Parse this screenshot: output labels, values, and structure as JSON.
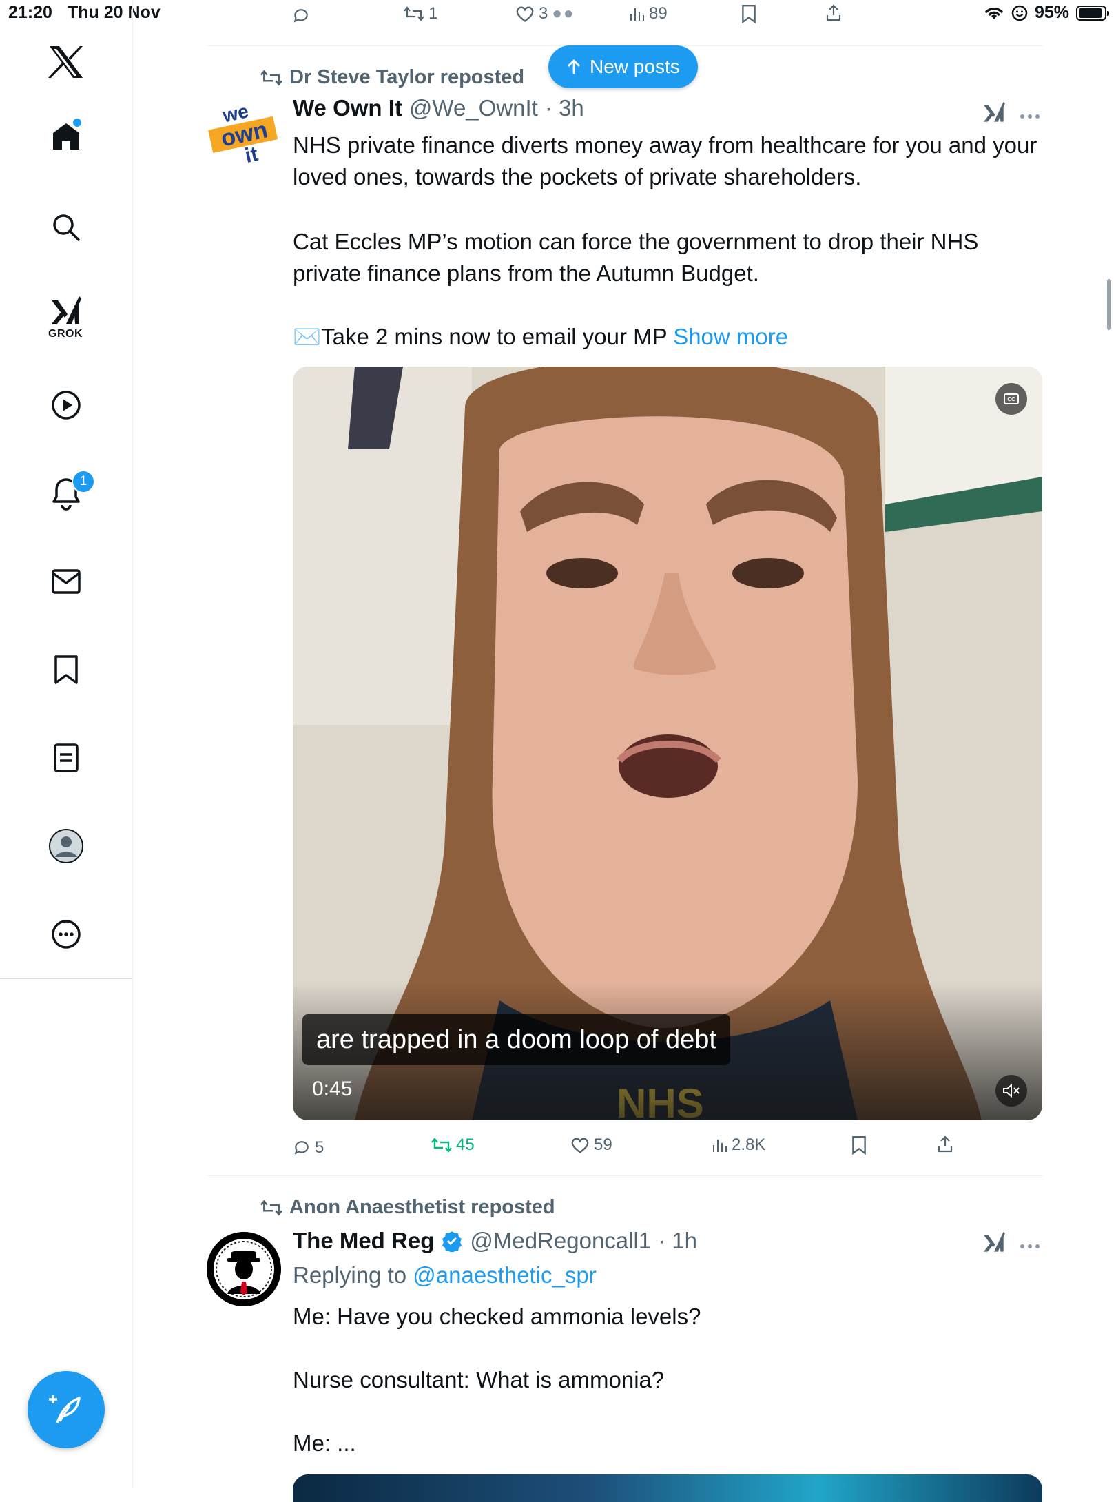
{
  "status_bar": {
    "time": "21:20",
    "date": "Thu 20 Nov",
    "battery": "95%",
    "battery_level": 0.95
  },
  "prev_tweet_actions": {
    "replies": "",
    "reposts": "1",
    "likes": "3",
    "views": "89"
  },
  "sidebar": {
    "grok_label": "GROK",
    "notifications_count": "1"
  },
  "new_posts": {
    "label": "New posts"
  },
  "tweet1": {
    "reposted_by": "Dr Steve Taylor reposted",
    "name": "We Own It",
    "handle": "@We_OwnIt",
    "time": "· 3h",
    "text_p1": "NHS private finance diverts money away from healthcare for you and your loved ones, towards the pockets of private shareholders.",
    "text_p2": "Cat Eccles MP’s motion can force the government to drop their NHS private finance plans from the Autumn Budget.",
    "text_p3": "✉️Take 2 mins now to email your MP ",
    "show_more": "Show more",
    "avatar_text_1": "we",
    "avatar_text_2": "own",
    "avatar_text_3": "it",
    "video": {
      "caption": "are trapped in a doom loop of debt",
      "duration": "0:45",
      "cc": "CC"
    },
    "actions": {
      "replies": "5",
      "reposts": "45",
      "likes": "59",
      "views": "2.8K"
    }
  },
  "tweet2": {
    "reposted_by": "Anon Anaesthetist reposted",
    "name": "The Med Reg",
    "handle": "@MedRegoncall1",
    "time": "· 1h",
    "replying_prefix": "Replying to ",
    "replying_to": "@anaesthetic_spr",
    "line1": "Me: Have you checked ammonia levels?",
    "line2": "Nurse consultant: What is ammonia?",
    "line3": "Me: ..."
  },
  "colors": {
    "accent": "#1d9bf0",
    "repost_green": "#00ba7c",
    "muted": "#536471"
  }
}
